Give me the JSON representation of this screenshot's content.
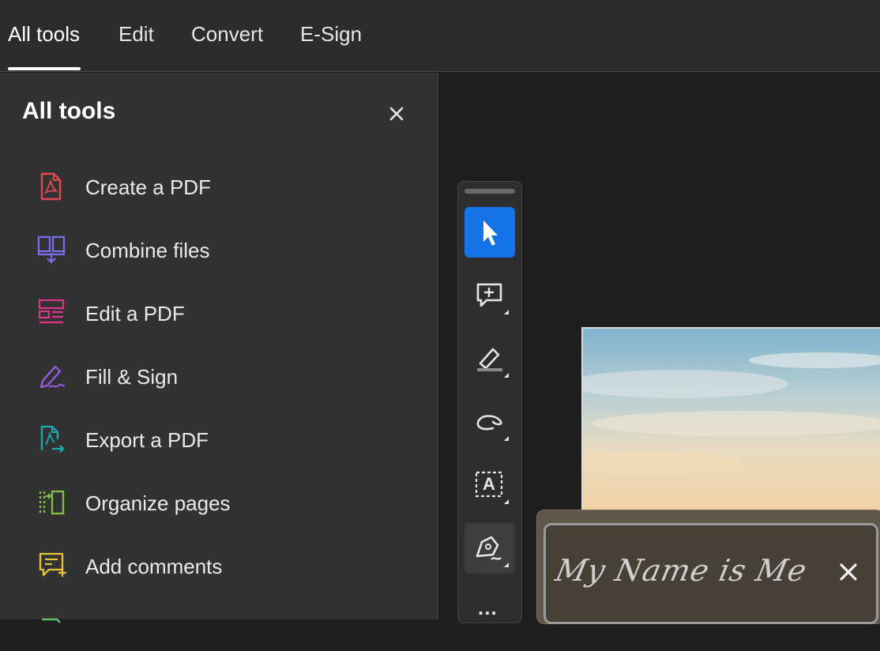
{
  "tabs": [
    {
      "label": "All tools"
    },
    {
      "label": "Edit"
    },
    {
      "label": "Convert"
    },
    {
      "label": "E-Sign"
    }
  ],
  "panel": {
    "title": "All tools",
    "close_icon": "close-icon"
  },
  "tools": [
    {
      "label": "Create a PDF",
      "icon": "create-pdf-icon",
      "color": "#e34850"
    },
    {
      "label": "Combine files",
      "icon": "combine-files-icon",
      "color": "#7b6cf0"
    },
    {
      "label": "Edit a PDF",
      "icon": "edit-pdf-icon",
      "color": "#e0348c"
    },
    {
      "label": "Fill & Sign",
      "icon": "fill-sign-icon",
      "color": "#9a5ce6"
    },
    {
      "label": "Export a PDF",
      "icon": "export-pdf-icon",
      "color": "#1fa8b0"
    },
    {
      "label": "Organize pages",
      "icon": "organize-pages-icon",
      "color": "#7fc241"
    },
    {
      "label": "Add comments",
      "icon": "add-comments-icon",
      "color": "#e8c43a"
    }
  ],
  "quick_tools": [
    {
      "name": "select-cursor-icon",
      "selected": true
    },
    {
      "name": "add-comment-icon"
    },
    {
      "name": "highlight-icon"
    },
    {
      "name": "draw-freehand-icon"
    },
    {
      "name": "add-text-icon",
      "glyph": "A"
    },
    {
      "name": "sign-pen-icon"
    },
    {
      "name": "more-icon",
      "glyph": "..."
    }
  ],
  "signature": {
    "text": "My Name is Me"
  },
  "colors": {
    "accent": "#1473e6",
    "topbar": "#2c2c2c",
    "sidebar": "#323232",
    "canvas": "#1e1e1e"
  }
}
